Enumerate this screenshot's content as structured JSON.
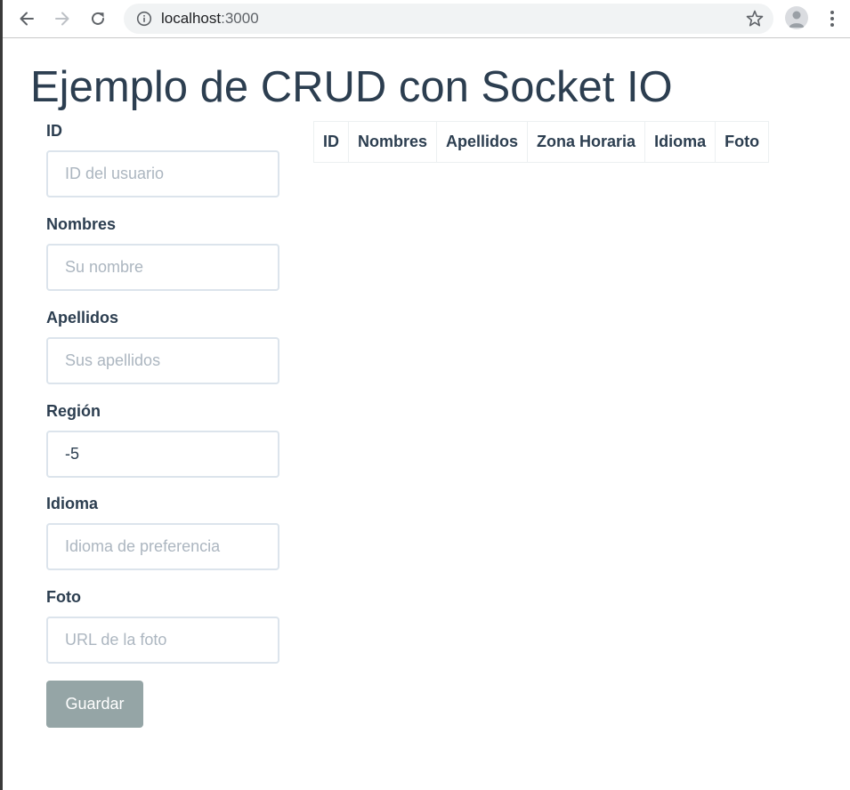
{
  "browser": {
    "url_host": "localhost",
    "url_port": ":3000"
  },
  "page": {
    "title": "Ejemplo de CRUD con Socket IO"
  },
  "form": {
    "fields": [
      {
        "label": "ID",
        "placeholder": "ID del usuario",
        "value": ""
      },
      {
        "label": "Nombres",
        "placeholder": "Su nombre",
        "value": ""
      },
      {
        "label": "Apellidos",
        "placeholder": "Sus apellidos",
        "value": ""
      },
      {
        "label": "Región",
        "placeholder": "",
        "value": "-5"
      },
      {
        "label": "Idioma",
        "placeholder": "Idioma de preferencia",
        "value": ""
      },
      {
        "label": "Foto",
        "placeholder": "URL de la foto",
        "value": ""
      }
    ],
    "save_label": "Guardar"
  },
  "table": {
    "headers": [
      "ID",
      "Nombres",
      "Apellidos",
      "Zona Horaria",
      "Idioma",
      "Foto"
    ]
  },
  "colors": {
    "text": "#2c3e50",
    "button_bg": "#95a5a6",
    "input_border": "#dce4ec",
    "placeholder": "#acb6c0",
    "table_border": "#ecf0f1"
  }
}
